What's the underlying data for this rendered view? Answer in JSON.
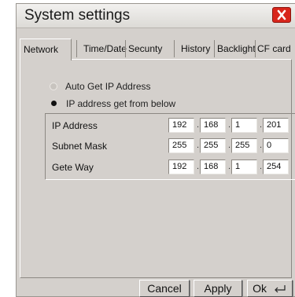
{
  "window": {
    "title": "System settings"
  },
  "tabs": [
    {
      "label": "Network"
    },
    {
      "label": "Time/Date"
    },
    {
      "label": "Secunty"
    },
    {
      "label": "History"
    },
    {
      "label": "Backlight"
    },
    {
      "label": "CF card"
    }
  ],
  "network": {
    "auto_option": "Auto   Get  IP  Address",
    "manual_option": "IP  address  get  from  below",
    "selected": "manual",
    "rows": [
      {
        "label": "IP Address",
        "octets": [
          "192",
          "168",
          "1",
          "201"
        ]
      },
      {
        "label": "Subnet Mask",
        "octets": [
          "255",
          "255",
          "255",
          "0"
        ]
      },
      {
        "label": "Gete Way",
        "octets": [
          "192",
          "168",
          "1",
          "254"
        ]
      }
    ],
    "separator": "."
  },
  "buttons": {
    "cancel": "Cancel",
    "apply": "Apply",
    "ok": "Ok"
  },
  "colors": {
    "close_button": "#d8261c",
    "window_background": "#d4d0cc"
  },
  "icons": {
    "close": "close-x-icon",
    "enter": "enter-arrow-icon"
  }
}
